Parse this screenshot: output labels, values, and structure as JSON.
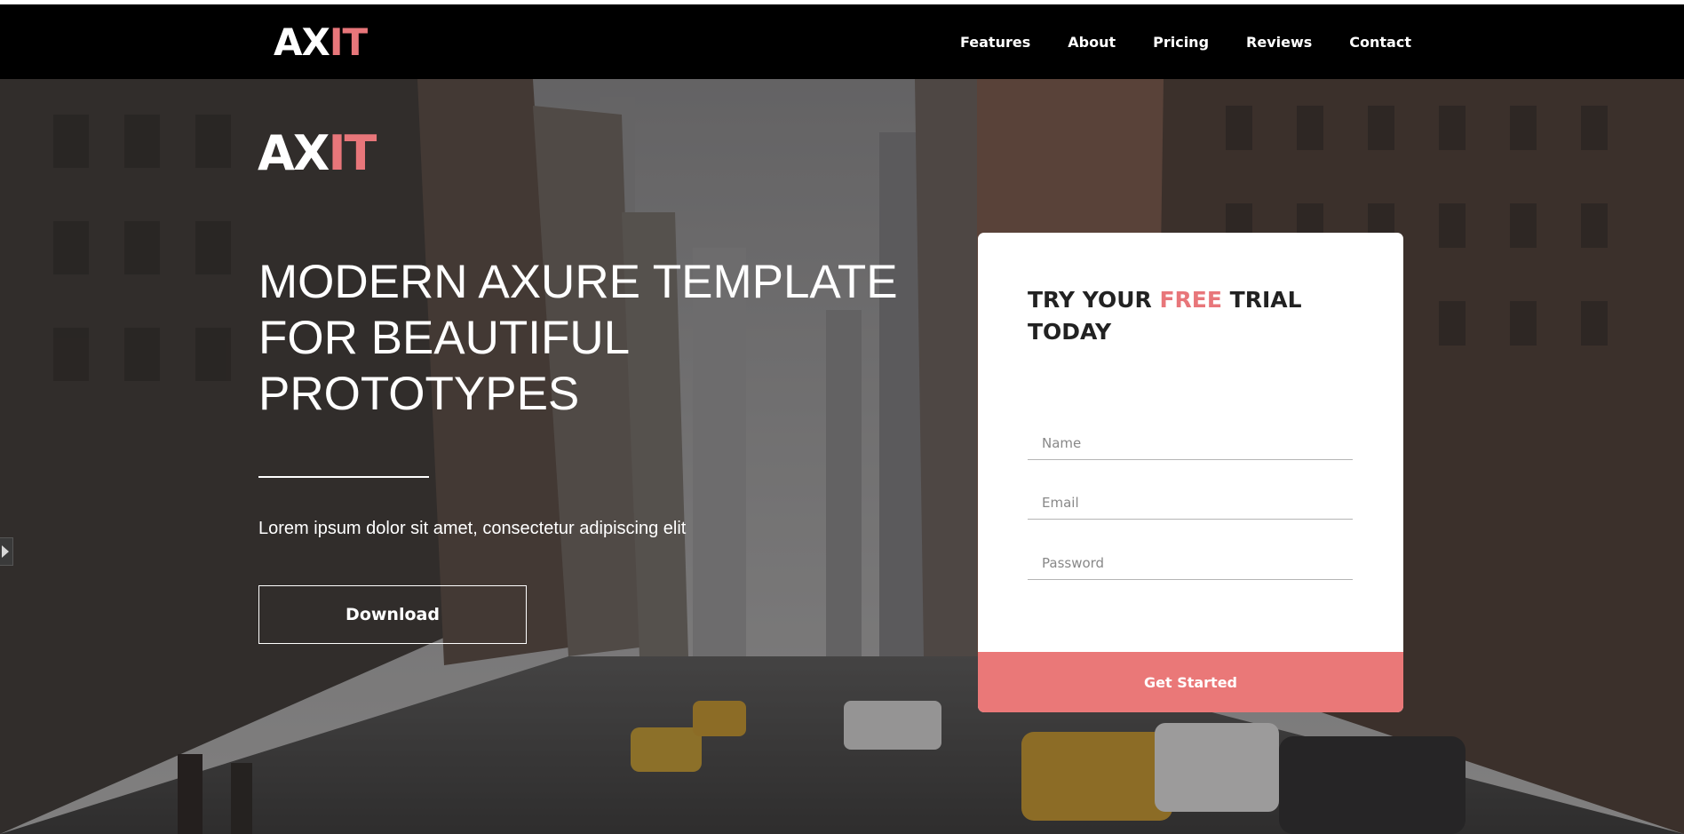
{
  "brand": {
    "logo_main": "AX",
    "logo_accent": "IT",
    "accent_color": "#e8767a"
  },
  "nav": {
    "items": [
      {
        "label": "Features"
      },
      {
        "label": "About"
      },
      {
        "label": "Pricing"
      },
      {
        "label": "Reviews"
      },
      {
        "label": "Contact"
      }
    ]
  },
  "hero": {
    "background": "city street photo with buildings and yellow taxis",
    "title_lines": [
      "MODERN AXURE TEMPLATE",
      "FOR BEAUTIFUL",
      "PROTOTYPES"
    ],
    "subtitle": "Lorem ipsum dolor sit amet, consectetur adipiscing elit",
    "download_label": "Download"
  },
  "trial": {
    "heading_before": "TRY YOUR ",
    "heading_accent": "FREE",
    "heading_after": " TRIAL TODAY",
    "fields": {
      "name_placeholder": "Name",
      "email_placeholder": "Email",
      "password_placeholder": "Password",
      "name_value": "",
      "email_value": "",
      "password_value": ""
    },
    "submit_label": "Get Started",
    "button_color": "#ea7878"
  }
}
